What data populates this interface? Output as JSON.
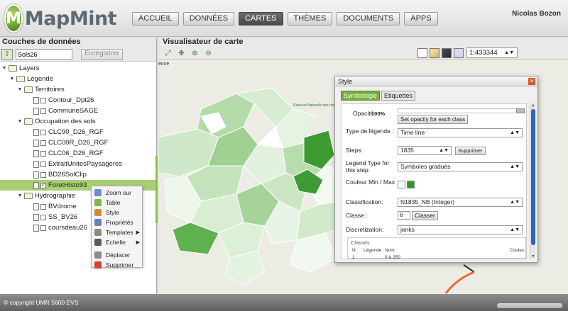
{
  "app": {
    "logo_letter": "M",
    "name": "MapMint",
    "user": "Nicolas Bozon"
  },
  "nav": [
    {
      "label": "ACCUEIL",
      "active": false
    },
    {
      "label": "DONNÉES",
      "active": false
    },
    {
      "label": "CARTES",
      "active": true
    },
    {
      "label": "THÈMES",
      "active": false
    },
    {
      "label": "DOCUMENTS",
      "active": false
    },
    {
      "label": "APPS",
      "active": false
    }
  ],
  "left_panel": {
    "title": "Couches de données",
    "name_value": "Sols26",
    "save_label": "Enregistrer",
    "tree": [
      {
        "label": "Layers",
        "level": 0,
        "type": "folder",
        "expanded": true
      },
      {
        "label": "Légende",
        "level": 1,
        "type": "folder",
        "expanded": true
      },
      {
        "label": "Territoires",
        "level": 2,
        "type": "folder",
        "expanded": true
      },
      {
        "label": "Contour_Dpt26",
        "level": 3,
        "type": "layer",
        "checked": false
      },
      {
        "label": "CommuneSAGE",
        "level": 3,
        "type": "layer",
        "checked": false
      },
      {
        "label": "Occupation des sols",
        "level": 2,
        "type": "folder",
        "expanded": true
      },
      {
        "label": "CLC90_D26_RGF",
        "level": 3,
        "type": "layer",
        "checked": false
      },
      {
        "label": "CLC00R_D26_RGF",
        "level": 3,
        "type": "layer",
        "checked": false
      },
      {
        "label": "CLC06_D26_RGF",
        "level": 3,
        "type": "layer",
        "checked": false
      },
      {
        "label": "ExtraitUnitesPaysageres",
        "level": 3,
        "type": "layer",
        "checked": false
      },
      {
        "label": "BD26SolClip",
        "level": 3,
        "type": "layer",
        "checked": false
      },
      {
        "label": "ForetHisto93",
        "level": 3,
        "type": "layer",
        "checked": true,
        "selected": true
      },
      {
        "label": "Hydrographie",
        "level": 2,
        "type": "folder",
        "expanded": true
      },
      {
        "label": "BVdrome",
        "level": 3,
        "type": "layer",
        "checked": false
      },
      {
        "label": "SS_BV26",
        "level": 3,
        "type": "layer",
        "checked": false
      },
      {
        "label": "coursdeau26",
        "level": 3,
        "type": "layer",
        "checked": false
      }
    ]
  },
  "context_menu": [
    {
      "label": "Zoom sur",
      "icon": "zoom-icon",
      "color": "#6a8fc4",
      "submenu": false
    },
    {
      "label": "Table",
      "icon": "table-icon",
      "color": "#7fb84a",
      "submenu": false
    },
    {
      "label": "Style",
      "icon": "palette-icon",
      "color": "#d08a3a",
      "submenu": false
    },
    {
      "label": "Propriétés",
      "icon": "properties-icon",
      "color": "#6c7fb8",
      "submenu": false
    },
    {
      "label": "Templates",
      "icon": "templates-icon",
      "color": "#8a8a8a",
      "submenu": true
    },
    {
      "label": "Echelle",
      "icon": "scale-icon",
      "color": "#5a5a5a",
      "submenu": true
    },
    {
      "label": "Déplacer",
      "icon": "move-icon",
      "color": "#8a8a8a",
      "submenu": false
    },
    {
      "label": "Supprimer",
      "icon": "delete-icon",
      "color": "#d9412b",
      "submenu": false
    }
  ],
  "map": {
    "title": "Visualisateur de carte",
    "scale": "1:433344",
    "label_edge": "ence",
    "label_reserve": "Réserve Naturelle des Hauts Plateaux du Vercors"
  },
  "style_dialog": {
    "title": "Style",
    "tabs": [
      "Symbologie",
      "Etiquettes"
    ],
    "opacity_label": "Opacité",
    "opacity_value": "100%",
    "opacity_button": "Set opacity for each class",
    "legend_type_label": "Type de légende :",
    "legend_type_value": "Time line",
    "steps_label": "Steps:",
    "steps_value": "1835",
    "steps_delete": "Supprimer",
    "legend_step_label": "Legend Type for this step:",
    "legend_step_value": "Symboles gradués",
    "color_label": "Couleur Min / Max",
    "color_min": "#ffffff",
    "color_max": "#2f9a2a",
    "classification_label": "Classification:",
    "classification_value": "N1835_NB (Integer)",
    "classe_label": "Classe :",
    "classe_value": "6",
    "classe_button": "Classer",
    "discretization_label": "Discretization:",
    "discretization_value": "jenks",
    "classes_title": "Classes",
    "classes_headers": [
      "N",
      "Légende",
      "Nom",
      "Couleu"
    ],
    "classes_row": [
      "1",
      "0 à 250"
    ]
  },
  "footer": {
    "copyright": "© copyright UMR 5600 EVS"
  }
}
